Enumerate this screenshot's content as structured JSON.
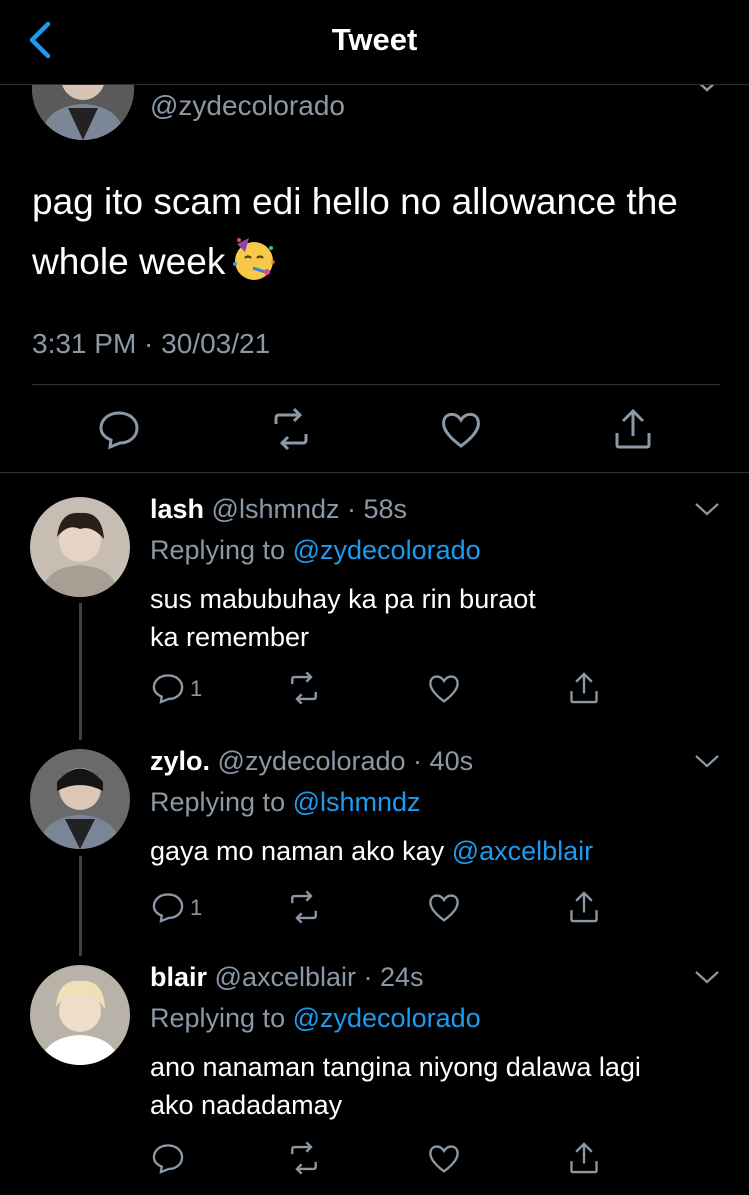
{
  "header": {
    "title": "Tweet"
  },
  "main_tweet": {
    "handle": "@zydecolorado",
    "text": "pag ito scam edi hello no allowance the whole week",
    "emoji": "partying-face",
    "timestamp": "3:31 PM · 30/03/21"
  },
  "replies": [
    {
      "name": "lash",
      "handle": "@lshmndz",
      "time": "58s",
      "replying_prefix": "Replying to",
      "replying_to": "@zydecolorado",
      "text_line1": "sus mabubuhay ka pa rin buraot",
      "text_line2": "ka remember",
      "reply_count": "1"
    },
    {
      "name": "zylo.",
      "handle": "@zydecolorado",
      "time": "40s",
      "replying_prefix": "Replying to",
      "replying_to": "@lshmndz",
      "text": "gaya mo naman ako kay",
      "mention": "@axcelblair",
      "reply_count": "1"
    },
    {
      "name": "blair",
      "handle": "@axcelblair",
      "time": "24s",
      "replying_prefix": "Replying to",
      "replying_to": "@zydecolorado",
      "text_line1": "ano nanaman tangina niyong dalawa lagi",
      "text_line2": "ako nadadamay",
      "reply_count": ""
    }
  ],
  "colors": {
    "background": "#000000",
    "accent": "#1d9bf0",
    "muted": "#8b98a5",
    "divider": "#2f3336"
  }
}
